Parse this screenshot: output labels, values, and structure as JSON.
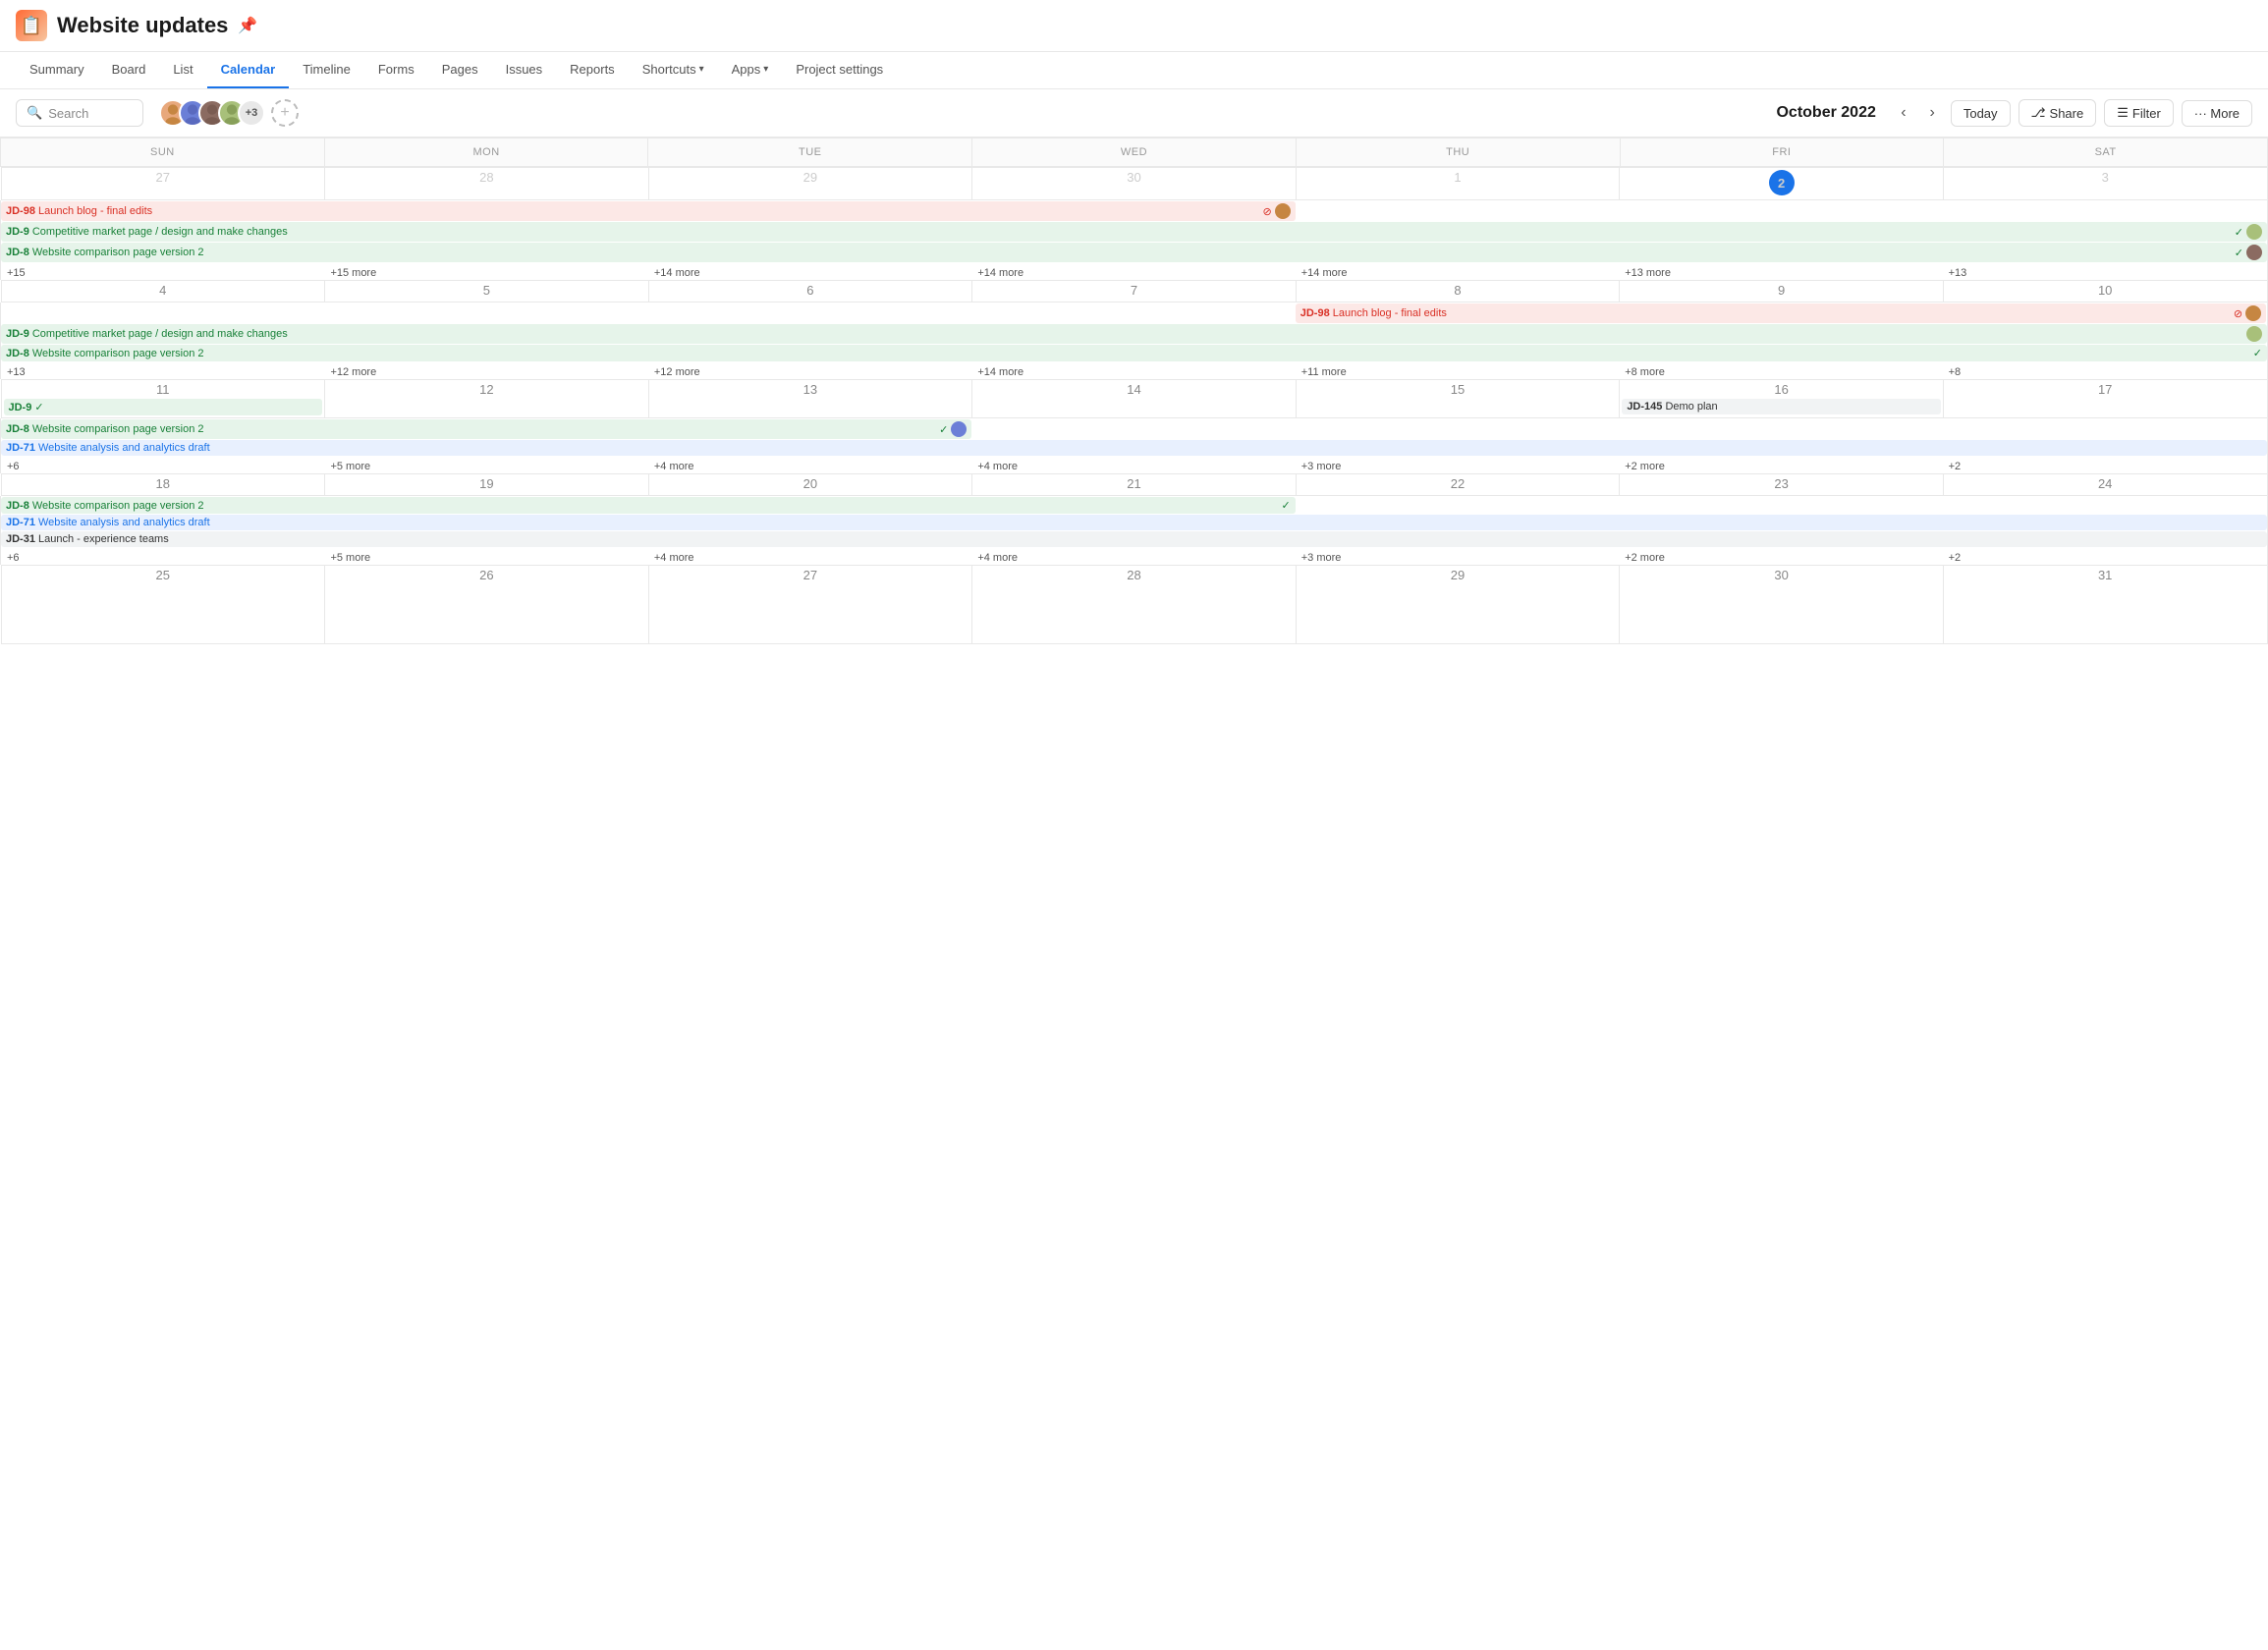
{
  "header": {
    "title": "Website updates",
    "icon": "📋"
  },
  "nav": {
    "tabs": [
      {
        "label": "Summary",
        "active": false
      },
      {
        "label": "Board",
        "active": false
      },
      {
        "label": "List",
        "active": false
      },
      {
        "label": "Calendar",
        "active": true
      },
      {
        "label": "Timeline",
        "active": false
      },
      {
        "label": "Forms",
        "active": false
      },
      {
        "label": "Pages",
        "active": false
      },
      {
        "label": "Issues",
        "active": false
      },
      {
        "label": "Reports",
        "active": false
      },
      {
        "label": "Shortcuts",
        "active": false,
        "dropdown": true
      },
      {
        "label": "Apps",
        "active": false,
        "dropdown": true
      },
      {
        "label": "Project settings",
        "active": false
      }
    ]
  },
  "toolbar": {
    "search_placeholder": "Search",
    "month_title": "October 2022",
    "today_label": "Today",
    "share_label": "Share",
    "filter_label": "Filter",
    "more_label": "··· More",
    "avatars_extra": "+3"
  },
  "calendar": {
    "days_of_week": [
      "SUN",
      "MON",
      "TUE",
      "WED",
      "THU",
      "FRI",
      "SAT"
    ],
    "weeks": [
      {
        "days": [
          {
            "num": 27,
            "out": true,
            "events": [],
            "more": "+15"
          },
          {
            "num": 28,
            "out": true,
            "events": [],
            "more": "+15 more"
          },
          {
            "num": 29,
            "out": true,
            "events": [],
            "more": "+14 more"
          },
          {
            "num": 30,
            "out": true,
            "events": [],
            "more": "+14 more"
          },
          {
            "num": 1,
            "out": false,
            "events": [],
            "more": "+14 more"
          },
          {
            "num": 2,
            "out": false,
            "today": true,
            "events": [],
            "more": "+13 more"
          },
          {
            "num": 3,
            "out": false,
            "events": [],
            "more": "+13"
          }
        ],
        "spanning": [
          {
            "id": "JD-98",
            "label": "Launch blog - final edits",
            "type": "red",
            "start": 0,
            "end": 3,
            "alert": true,
            "avatar": true
          },
          {
            "id": "JD-9",
            "label": "Competitive market page / design and make changes",
            "type": "green",
            "start": 0,
            "end": 6,
            "check": true,
            "avatar": true
          },
          {
            "id": "JD-8",
            "label": "Website comparison page version 2",
            "type": "green",
            "start": 0,
            "end": 6,
            "check": true,
            "avatar": true
          }
        ]
      },
      {
        "days": [
          {
            "num": 4,
            "out": false,
            "events": [],
            "more": "+13"
          },
          {
            "num": 5,
            "out": false,
            "events": [],
            "more": "+12 more"
          },
          {
            "num": 6,
            "out": false,
            "events": [],
            "more": "+12 more"
          },
          {
            "num": 7,
            "out": false,
            "events": [],
            "more": "+14 more"
          },
          {
            "num": 8,
            "out": false,
            "events": [],
            "more": "+11 more"
          },
          {
            "num": 9,
            "out": false,
            "events": [],
            "more": "+8 more"
          },
          {
            "num": 10,
            "out": false,
            "events": [],
            "more": "+8"
          }
        ],
        "spanning": [
          {
            "id": "JD-98",
            "label": "Launch blog - final edits",
            "type": "red",
            "start": 4,
            "end": 6,
            "alert": true,
            "avatar": true
          },
          {
            "id": "JD-9",
            "label": "Competitive market page / design and make changes",
            "type": "green",
            "start": 0,
            "end": 6,
            "check": false,
            "avatar": true
          },
          {
            "id": "JD-8",
            "label": "Website comparison page version 2",
            "type": "green",
            "start": 0,
            "end": 6,
            "check": true
          }
        ]
      },
      {
        "days": [
          {
            "num": 11,
            "out": false,
            "events": [
              {
                "id": "JD-9",
                "label": "",
                "type": "green",
                "check": true
              }
            ],
            "more": "+6"
          },
          {
            "num": 12,
            "out": false,
            "events": [],
            "more": "+5 more"
          },
          {
            "num": 13,
            "out": false,
            "events": [],
            "more": "+4 more"
          },
          {
            "num": 14,
            "out": false,
            "events": [],
            "more": "+4 more"
          },
          {
            "num": 15,
            "out": false,
            "events": [],
            "more": "+3 more"
          },
          {
            "num": 16,
            "out": false,
            "events": [
              {
                "id": "JD-145",
                "label": "Demo plan",
                "type": "gray"
              }
            ],
            "more": "+2 more"
          },
          {
            "num": 17,
            "out": false,
            "events": [],
            "more": "+2"
          }
        ],
        "spanning": [
          {
            "id": "JD-8",
            "label": "Website comparison page version 2",
            "type": "green",
            "start": 0,
            "end": 2,
            "check": true,
            "avatar": true
          },
          {
            "id": "JD-71",
            "label": "Website analysis and analytics draft",
            "type": "blue",
            "start": 0,
            "end": 6
          }
        ]
      },
      {
        "days": [
          {
            "num": 18,
            "out": false,
            "events": [],
            "more": "+6"
          },
          {
            "num": 19,
            "out": false,
            "events": [],
            "more": "+5 more"
          },
          {
            "num": 20,
            "out": false,
            "events": [],
            "more": "+4 more"
          },
          {
            "num": 21,
            "out": false,
            "events": [],
            "more": "+4 more"
          },
          {
            "num": 22,
            "out": false,
            "events": [],
            "more": "+3 more"
          },
          {
            "num": 23,
            "out": false,
            "events": [],
            "more": "+2 more"
          },
          {
            "num": 24,
            "out": false,
            "events": [],
            "more": "+2"
          }
        ],
        "spanning": [
          {
            "id": "JD-8",
            "label": "Website comparison page version 2",
            "type": "green",
            "start": 0,
            "end": 3,
            "check": true
          },
          {
            "id": "JD-71",
            "label": "Website analysis and analytics draft",
            "type": "blue",
            "start": 0,
            "end": 6
          },
          {
            "id": "JD-31",
            "label": "Launch - experience teams",
            "type": "gray",
            "start": 0,
            "end": 6
          }
        ]
      },
      {
        "days": [
          {
            "num": 25,
            "out": false,
            "events": [],
            "more": ""
          },
          {
            "num": 26,
            "out": false,
            "events": [],
            "more": ""
          },
          {
            "num": 27,
            "out": false,
            "events": [],
            "more": ""
          },
          {
            "num": 28,
            "out": false,
            "events": [],
            "more": ""
          },
          {
            "num": 29,
            "out": false,
            "events": [],
            "more": ""
          },
          {
            "num": 30,
            "out": false,
            "events": [],
            "more": ""
          },
          {
            "num": 31,
            "out": false,
            "events": [],
            "more": ""
          }
        ],
        "spanning": []
      }
    ]
  }
}
